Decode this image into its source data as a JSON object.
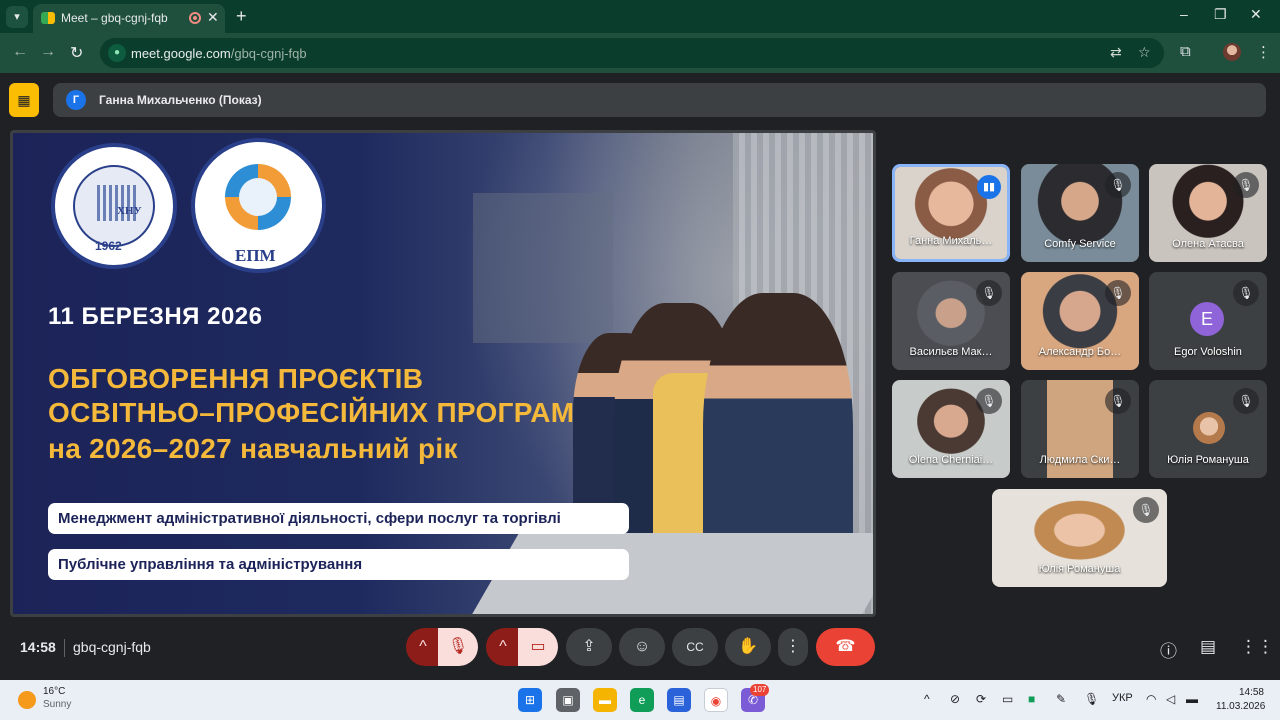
{
  "browser": {
    "tab_title": "Meet – gbq-cgnj-fqb",
    "new_tab": "+",
    "url_host": "meet.google.com",
    "url_path": "/gbq-cgnj-fqb",
    "window_controls": [
      "–",
      "❐",
      "✕"
    ]
  },
  "meet": {
    "presenter_badge": "Г",
    "presenter_label": "Ганна Михальченко (Показ)",
    "slide": {
      "logo1_text": "ХНУ",
      "logo1_year": "1962",
      "logo2_text": "ЕПМ",
      "date": "11 БЕРЕЗНЯ 2026",
      "heading_line1": "ОБГОВОРЕННЯ ПРОЄКТІВ",
      "heading_line2": "ОСВІТНЬО–ПРОФЕСІЙНИХ ПРОГРАМ",
      "heading_line3": "на 2026–2027 навчальний рік",
      "program1": "Менеджмент адміністративної діяльності, сфери послуг та торгівлі",
      "program2": "Публічне управління та адміністрування"
    },
    "participants": [
      {
        "name": "Ганна Михаль…",
        "state": "speaking"
      },
      {
        "name": "Comfy Service",
        "state": "muted"
      },
      {
        "name": "Олена Атасва",
        "state": "muted"
      },
      {
        "name": "Васильєв Мак…",
        "state": "muted"
      },
      {
        "name": "Александр Бо…",
        "state": "muted"
      },
      {
        "name": "Egor Voloshin",
        "state": "muted",
        "avatar_letter": "E"
      },
      {
        "name": "Olena Cherniai…",
        "state": "muted"
      },
      {
        "name": "Людмила Ски…",
        "state": "muted"
      },
      {
        "name": "Юлія Романуша",
        "state": "muted"
      },
      {
        "name": "Юлія Романуша",
        "state": "muted"
      }
    ],
    "bottom": {
      "time": "14:58",
      "meeting_code": "gbq-cgnj-fqb"
    }
  },
  "taskbar": {
    "weather_temp": "16°C",
    "weather_desc": "Sunny",
    "notification_count": "107",
    "language": "УКР",
    "time": "14:58",
    "date": "11.03.2026"
  },
  "colors": {
    "chrome_frame": "#0b3d2c",
    "chrome_toolbar": "#1f4f3d",
    "meet_bg": "#202124",
    "slide_heading": "#f4b93a",
    "end_call": "#ea4335",
    "active_speaker": "#8ab4f8"
  }
}
